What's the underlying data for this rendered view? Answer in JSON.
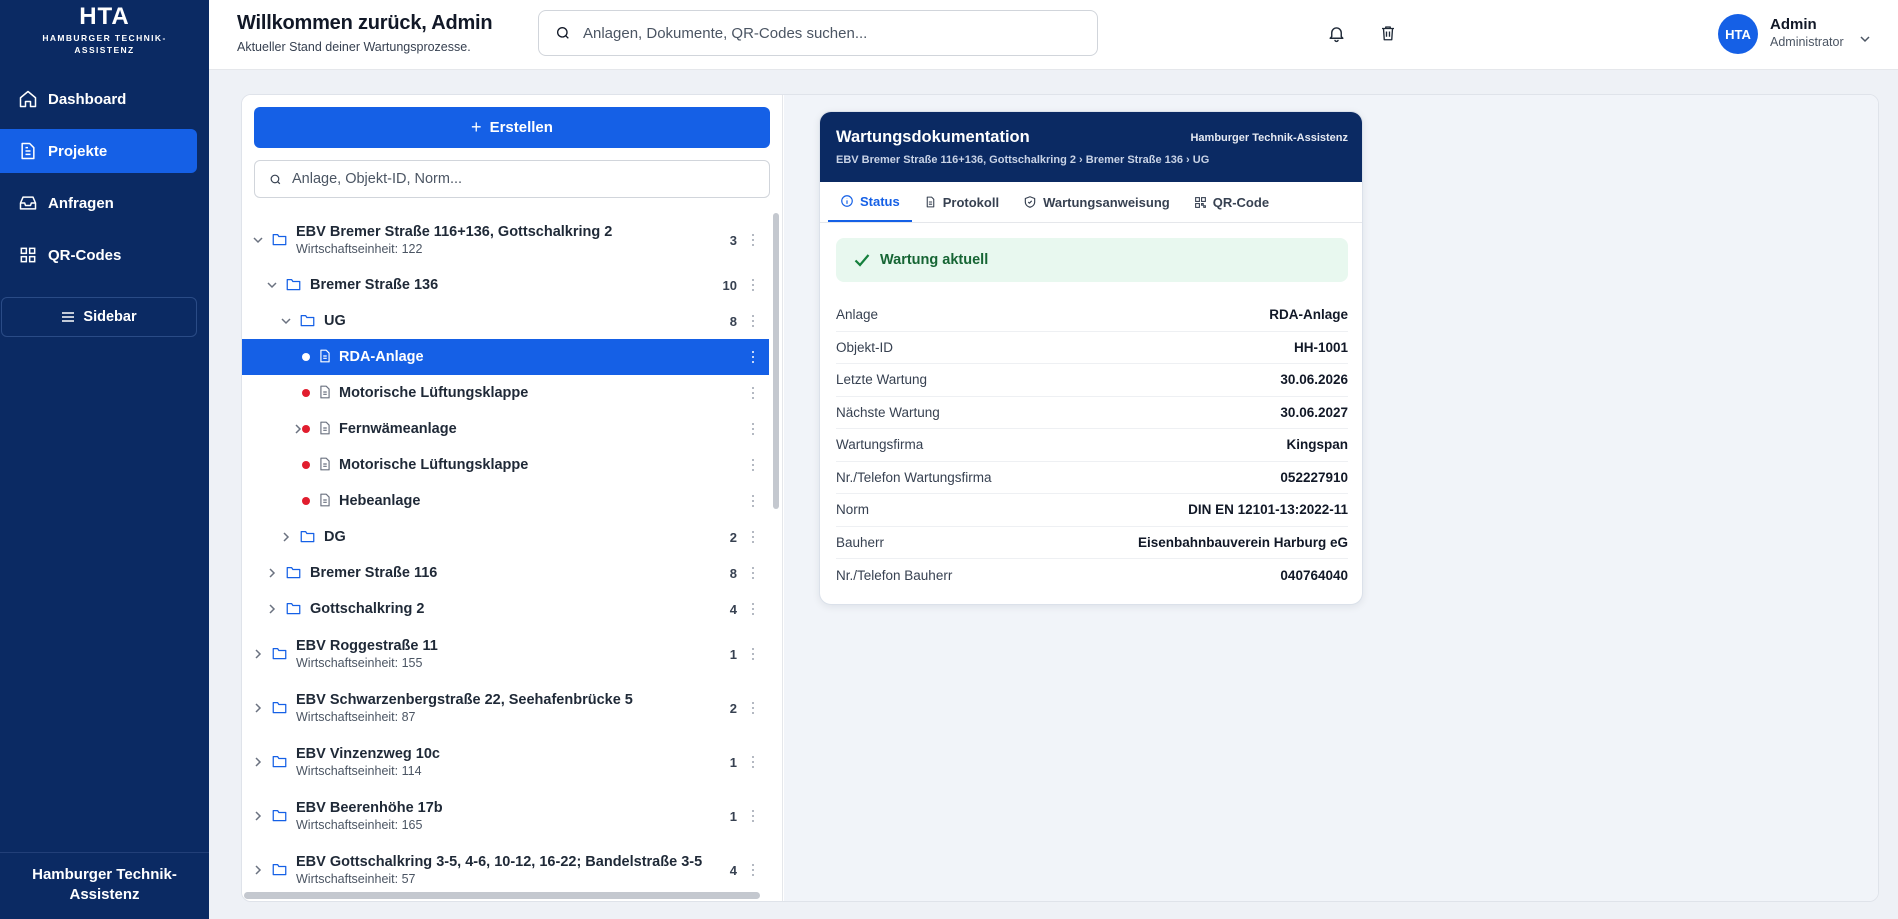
{
  "brand": {
    "logo": "HTA",
    "subtitle_line1": "HAMBURGER TECHNIK-",
    "subtitle_line2": "ASSISTENZ"
  },
  "nav": [
    {
      "label": "Dashboard",
      "icon": "home-icon",
      "active": false
    },
    {
      "label": "Projekte",
      "icon": "projects-icon",
      "active": true
    },
    {
      "label": "Anfragen",
      "icon": "inbox-icon",
      "active": false
    },
    {
      "label": "QR-Codes",
      "icon": "grid-icon",
      "active": false
    }
  ],
  "sidebar_toggle_label": "Sidebar",
  "sidebar_footer": {
    "line1": "Hamburger Technik-",
    "line2": "Assistenz"
  },
  "header": {
    "title": "Willkommen zurück, Admin",
    "subtitle": "Aktueller Stand deiner Wartungsprozesse.",
    "search_placeholder": "Anlagen, Dokumente, QR-Codes suchen...",
    "user_initials": "HTA",
    "user_name": "Admin",
    "user_role": "Administrator"
  },
  "tree_panel": {
    "create_label": "Erstellen",
    "search_placeholder": "Anlage, Objekt-ID, Norm...",
    "rows": [
      {
        "label": "EBV Bremer Straße 116+136, Gottschalkring 2",
        "sub": "Wirtschaftseinheit: 122",
        "count": "3"
      },
      {
        "label": "Bremer Straße 136",
        "count": "10"
      },
      {
        "label": "UG",
        "count": "8"
      },
      {
        "label": "RDA-Anlage"
      },
      {
        "label": "Motorische Lüftungsklappe"
      },
      {
        "label": "Fernwämeanlage"
      },
      {
        "label": "Motorische Lüftungsklappe"
      },
      {
        "label": "Hebeanlage"
      },
      {
        "label": "DG",
        "count": "2"
      },
      {
        "label": "Bremer Straße 116",
        "count": "8"
      },
      {
        "label": "Gottschalkring 2",
        "count": "4"
      },
      {
        "label": "EBV Roggestraße 11",
        "sub": "Wirtschaftseinheit: 155",
        "count": "1"
      },
      {
        "label": "EBV Schwarzenbergstraße 22, Seehafenbrücke 5",
        "sub": "Wirtschaftseinheit: 87",
        "count": "2"
      },
      {
        "label": "EBV Vinzenzweg 10c",
        "sub": "Wirtschaftseinheit: 114",
        "count": "1"
      },
      {
        "label": "EBV Beerenhöhe 17b",
        "sub": "Wirtschaftseinheit: 165",
        "count": "1"
      },
      {
        "label": "EBV Gottschalkring 3-5, 4-6, 10-12, 16-22; Bandelstraße 3-5",
        "sub": "Wirtschaftseinheit: 57",
        "count": "4"
      }
    ]
  },
  "doc": {
    "title": "Wartungsdokumentation",
    "org": "Hamburger Technik-Assistenz",
    "breadcrumb": "EBV Bremer Straße 116+136, Gottschalkring 2 › Bremer Straße 136 › UG",
    "tabs": [
      "Status",
      "Protokoll",
      "Wartungsanweisung",
      "QR-Code"
    ],
    "status_text": "Wartung aktuell",
    "fields": [
      {
        "k": "Anlage",
        "v": "RDA-Anlage"
      },
      {
        "k": "Objekt-ID",
        "v": "HH-1001"
      },
      {
        "k": "Letzte Wartung",
        "v": "30.06.2026"
      },
      {
        "k": "Nächste Wartung",
        "v": "30.06.2027"
      },
      {
        "k": "Wartungsfirma",
        "v": "Kingspan"
      },
      {
        "k": "Nr./Telefon Wartungsfirma",
        "v": "052227910"
      },
      {
        "k": "Norm",
        "v": "DIN EN 12101-13:2022-11"
      },
      {
        "k": "Bauherr",
        "v": "Eisenbahnbauverein Harburg eG"
      },
      {
        "k": "Nr./Telefon Bauherr",
        "v": "040764040"
      }
    ]
  },
  "colors": {
    "navy": "#0b2a63",
    "accent": "#1560e6",
    "alert_dot": "#e11d2e",
    "success_bg": "#e8f8ef",
    "success_text": "#166534"
  }
}
